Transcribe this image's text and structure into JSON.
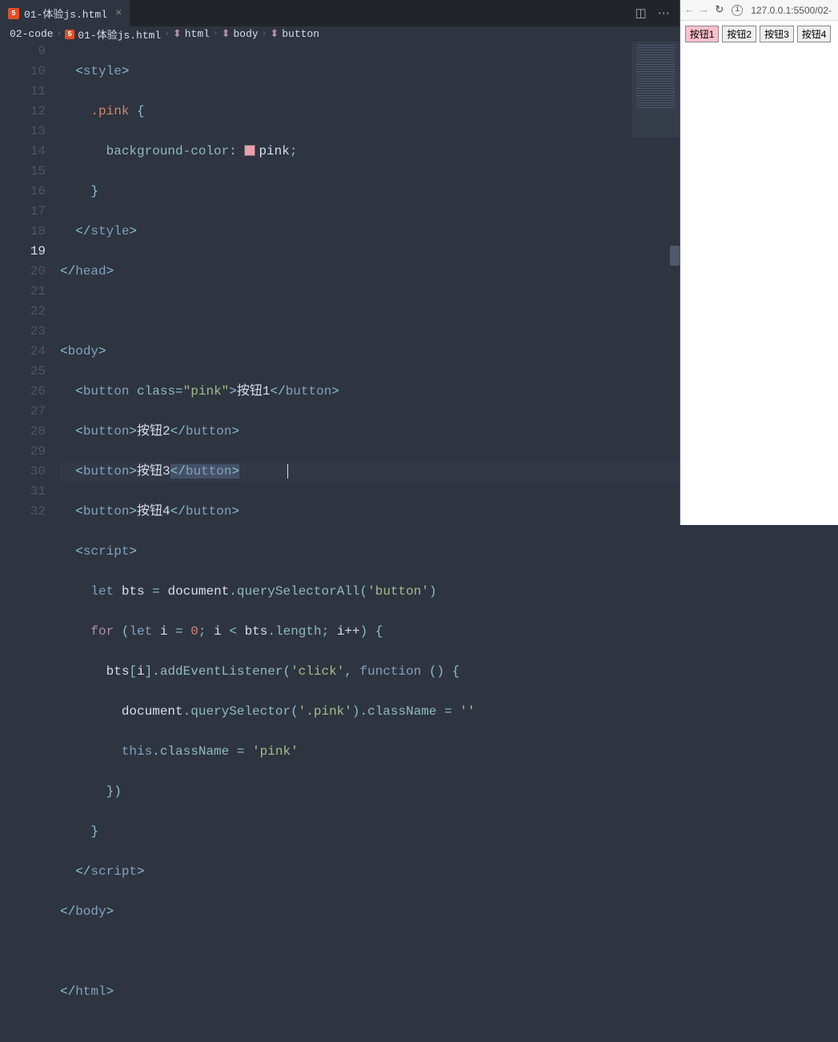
{
  "tab": {
    "filename": "01-体验js.html"
  },
  "breadcrumb": {
    "folder": "02-code",
    "file": "01-体验js.html",
    "path1": "html",
    "path2": "body",
    "path3": "button"
  },
  "lines": [
    "9",
    "10",
    "11",
    "12",
    "13",
    "14",
    "15",
    "16",
    "17",
    "18",
    "19",
    "20",
    "21",
    "22",
    "23",
    "24",
    "25",
    "26",
    "27",
    "28",
    "29",
    "30",
    "31",
    "32"
  ],
  "activeLine": "19",
  "code": {
    "style_open": "style",
    "class_sel": ".pink",
    "brace_open": "{",
    "bg_prop": "background-color",
    "bg_val": "pink",
    "brace_close": "}",
    "style_close": "style",
    "head_close": "head",
    "body_open": "body",
    "btn_tag": "button",
    "class_attr": "class",
    "class_val": "\"pink\"",
    "btn1_text": "按钮1",
    "btn2_text": "按钮2",
    "btn3_text": "按钮3",
    "btn4_text": "按钮4",
    "script_tag": "script",
    "let_kw": "let",
    "bts_var": "bts",
    "doc_var": "document",
    "qsa": "querySelectorAll",
    "btn_str": "'button'",
    "for_kw": "for",
    "i_var": "i",
    "zero": "0",
    "length_prop": "length",
    "ipp": "i++",
    "ael": "addEventListener",
    "click_str": "'click'",
    "func_kw": "function",
    "qs": "querySelector",
    "pink_str": "'.pink'",
    "cn_prop": "className",
    "empty_str": "''",
    "this_kw": "this",
    "pink_str2": "'pink'",
    "body_close": "body",
    "html_close": "html"
  },
  "browser": {
    "url": "127.0.0.1:5500/02-",
    "buttons": [
      "按钮1",
      "按钮2",
      "按钮3",
      "按钮4"
    ]
  }
}
